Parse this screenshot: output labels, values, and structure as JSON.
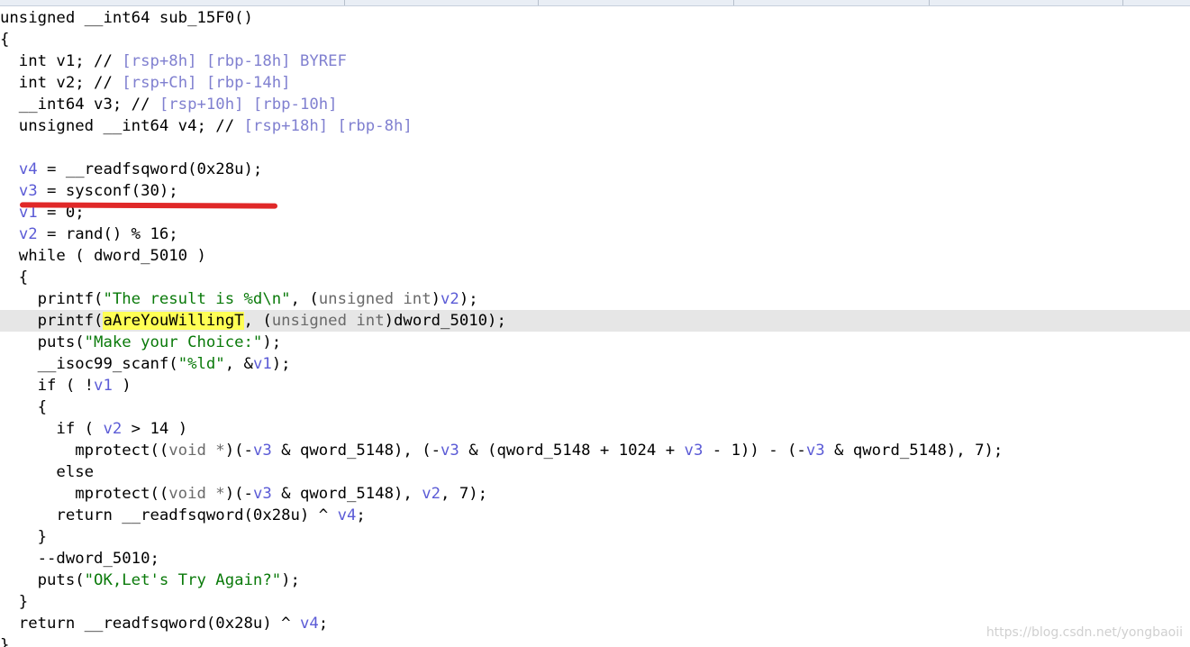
{
  "colors": {
    "plain": "#000000",
    "variable": "#5b5bd6",
    "comment": "#8080d0",
    "string": "#0a7a0a",
    "type": "#6a6a6a",
    "highlight": "#ffff55",
    "line_highlight": "#e6e6e6",
    "annotation_underline": "#e02828"
  },
  "code_lines": [
    {
      "tokens": [
        {
          "t": "unsigned __int64 sub_15F0()",
          "c": "plain"
        }
      ]
    },
    {
      "tokens": [
        {
          "t": "{",
          "c": "plain"
        }
      ]
    },
    {
      "tokens": [
        {
          "t": "  int v1; // ",
          "c": "plain"
        },
        {
          "t": "[rsp+8h] [rbp-18h] BYREF",
          "c": "cmt"
        }
      ]
    },
    {
      "tokens": [
        {
          "t": "  int v2; // ",
          "c": "plain"
        },
        {
          "t": "[rsp+Ch] [rbp-14h]",
          "c": "cmt"
        }
      ]
    },
    {
      "tokens": [
        {
          "t": "  __int64 v3; // ",
          "c": "plain"
        },
        {
          "t": "[rsp+10h] [rbp-10h]",
          "c": "cmt"
        }
      ]
    },
    {
      "tokens": [
        {
          "t": "  unsigned __int64 v4; // ",
          "c": "plain"
        },
        {
          "t": "[rsp+18h] [rbp-8h]",
          "c": "cmt"
        }
      ]
    },
    {
      "tokens": [
        {
          "t": "",
          "c": "plain"
        }
      ]
    },
    {
      "tokens": [
        {
          "t": "  ",
          "c": "plain"
        },
        {
          "t": "v4",
          "c": "var"
        },
        {
          "t": " = __readfsqword(0x28u);",
          "c": "plain"
        }
      ]
    },
    {
      "tokens": [
        {
          "t": "  ",
          "c": "plain"
        },
        {
          "t": "v3",
          "c": "var"
        },
        {
          "t": " = sysconf(30);",
          "c": "plain"
        }
      ]
    },
    {
      "tokens": [
        {
          "t": "  ",
          "c": "plain"
        },
        {
          "t": "v1",
          "c": "var"
        },
        {
          "t": " = 0;",
          "c": "plain"
        }
      ]
    },
    {
      "tokens": [
        {
          "t": "  ",
          "c": "plain"
        },
        {
          "t": "v2",
          "c": "var"
        },
        {
          "t": " = rand() % 16;",
          "c": "plain"
        }
      ]
    },
    {
      "tokens": [
        {
          "t": "  while ( dword_5010 )",
          "c": "plain"
        }
      ]
    },
    {
      "tokens": [
        {
          "t": "  {",
          "c": "plain"
        }
      ]
    },
    {
      "tokens": [
        {
          "t": "    printf(",
          "c": "plain"
        },
        {
          "t": "\"The result is %d\\n\"",
          "c": "str"
        },
        {
          "t": ", (",
          "c": "plain"
        },
        {
          "t": "unsigned int",
          "c": "type"
        },
        {
          "t": ")",
          "c": "plain"
        },
        {
          "t": "v2",
          "c": "var"
        },
        {
          "t": ");",
          "c": "plain"
        }
      ]
    },
    {
      "highlighted": true,
      "tokens": [
        {
          "t": "    printf(",
          "c": "plain"
        },
        {
          "t": "aAreYouWillingT",
          "c": "hl"
        },
        {
          "t": ", (",
          "c": "plain"
        },
        {
          "t": "unsigned int",
          "c": "type"
        },
        {
          "t": ")dword_5010);",
          "c": "plain"
        }
      ]
    },
    {
      "tokens": [
        {
          "t": "    puts(",
          "c": "plain"
        },
        {
          "t": "\"Make your Choice:\"",
          "c": "str"
        },
        {
          "t": ");",
          "c": "plain"
        }
      ]
    },
    {
      "tokens": [
        {
          "t": "    __isoc99_scanf(",
          "c": "plain"
        },
        {
          "t": "\"%ld\"",
          "c": "str"
        },
        {
          "t": ", &",
          "c": "plain"
        },
        {
          "t": "v1",
          "c": "var"
        },
        {
          "t": ");",
          "c": "plain"
        }
      ]
    },
    {
      "tokens": [
        {
          "t": "    if ( !",
          "c": "plain"
        },
        {
          "t": "v1",
          "c": "var"
        },
        {
          "t": " )",
          "c": "plain"
        }
      ]
    },
    {
      "tokens": [
        {
          "t": "    {",
          "c": "plain"
        }
      ]
    },
    {
      "tokens": [
        {
          "t": "      if ( ",
          "c": "plain"
        },
        {
          "t": "v2",
          "c": "var"
        },
        {
          "t": " > 14 )",
          "c": "plain"
        }
      ]
    },
    {
      "tokens": [
        {
          "t": "        mprotect((",
          "c": "plain"
        },
        {
          "t": "void *",
          "c": "type"
        },
        {
          "t": ")(-",
          "c": "plain"
        },
        {
          "t": "v3",
          "c": "var"
        },
        {
          "t": " & qword_5148), (-",
          "c": "plain"
        },
        {
          "t": "v3",
          "c": "var"
        },
        {
          "t": " & (qword_5148 + 1024 + ",
          "c": "plain"
        },
        {
          "t": "v3",
          "c": "var"
        },
        {
          "t": " - 1)) - (-",
          "c": "plain"
        },
        {
          "t": "v3",
          "c": "var"
        },
        {
          "t": " & qword_5148), 7);",
          "c": "plain"
        }
      ]
    },
    {
      "tokens": [
        {
          "t": "      else",
          "c": "plain"
        }
      ]
    },
    {
      "tokens": [
        {
          "t": "        mprotect((",
          "c": "plain"
        },
        {
          "t": "void *",
          "c": "type"
        },
        {
          "t": ")(-",
          "c": "plain"
        },
        {
          "t": "v3",
          "c": "var"
        },
        {
          "t": " & qword_5148), ",
          "c": "plain"
        },
        {
          "t": "v2",
          "c": "var"
        },
        {
          "t": ", 7);",
          "c": "plain"
        }
      ]
    },
    {
      "tokens": [
        {
          "t": "      return __readfsqword(0x28u) ^ ",
          "c": "plain"
        },
        {
          "t": "v4",
          "c": "var"
        },
        {
          "t": ";",
          "c": "plain"
        }
      ]
    },
    {
      "tokens": [
        {
          "t": "    }",
          "c": "plain"
        }
      ]
    },
    {
      "tokens": [
        {
          "t": "    --dword_5010;",
          "c": "plain"
        }
      ]
    },
    {
      "tokens": [
        {
          "t": "    puts(",
          "c": "plain"
        },
        {
          "t": "\"OK,Let's Try Again?\"",
          "c": "str"
        },
        {
          "t": ");",
          "c": "plain"
        }
      ]
    },
    {
      "tokens": [
        {
          "t": "  }",
          "c": "plain"
        }
      ]
    },
    {
      "tokens": [
        {
          "t": "  return __readfsqword(0x28u) ^ ",
          "c": "plain"
        },
        {
          "t": "v4",
          "c": "var"
        },
        {
          "t": ";",
          "c": "plain"
        }
      ]
    },
    {
      "tokens": [
        {
          "t": "}",
          "c": "plain"
        }
      ]
    }
  ],
  "watermark": "https://blog.csdn.net/yongbaoii"
}
